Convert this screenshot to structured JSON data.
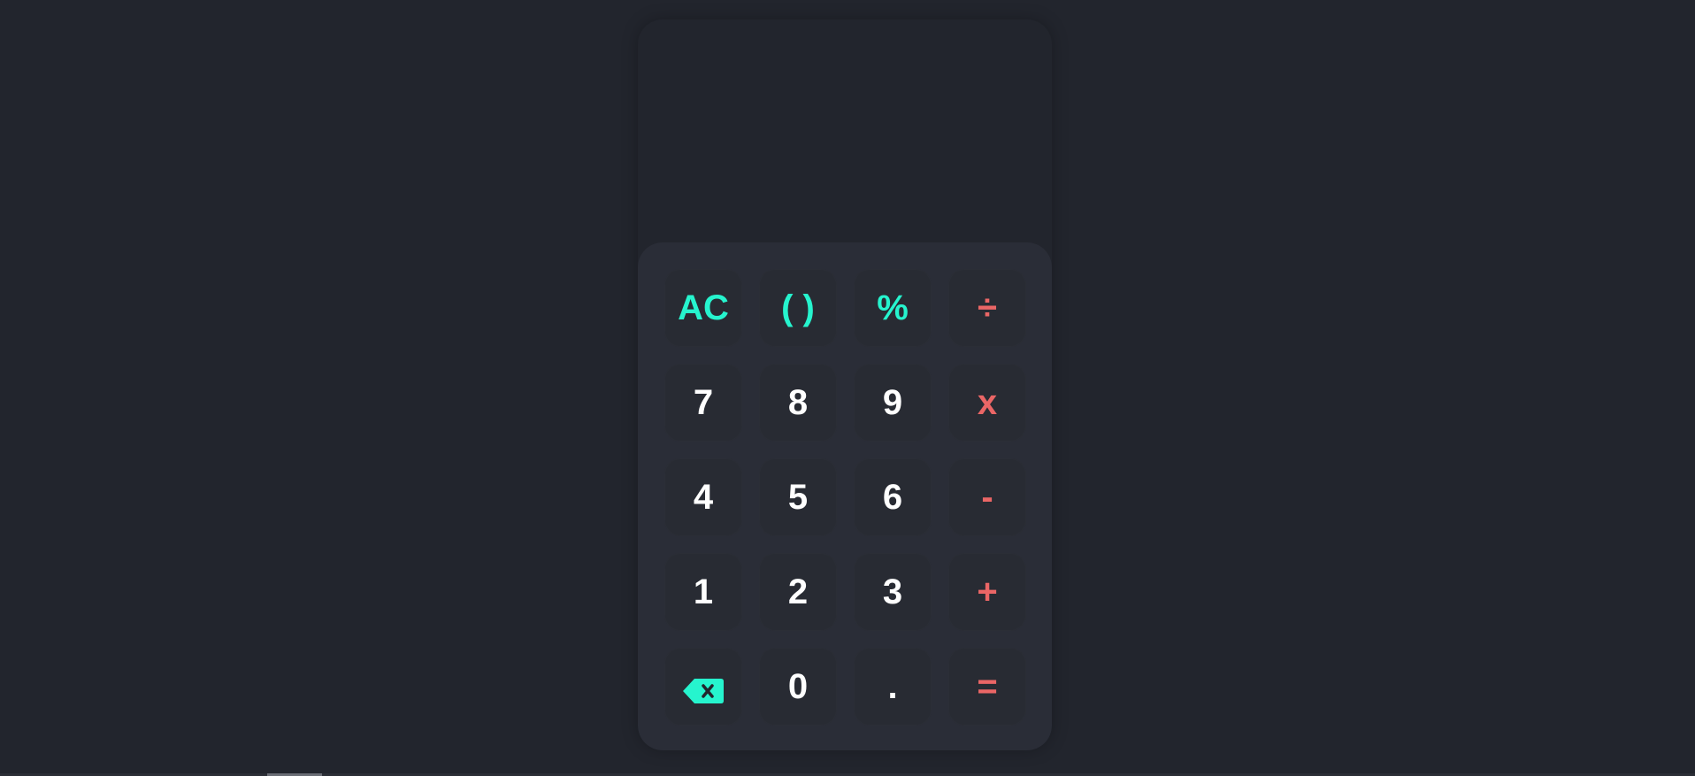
{
  "calculator": {
    "display": {
      "value": ""
    },
    "keys": [
      {
        "label": "AC",
        "type": "fn",
        "name": "clear-button"
      },
      {
        "label": "( )",
        "type": "fn",
        "name": "parentheses-button"
      },
      {
        "label": "%",
        "type": "fn",
        "name": "percent-button"
      },
      {
        "label": "÷",
        "type": "op",
        "name": "divide-button"
      },
      {
        "label": "7",
        "type": "num",
        "name": "digit-7-button"
      },
      {
        "label": "8",
        "type": "num",
        "name": "digit-8-button"
      },
      {
        "label": "9",
        "type": "num",
        "name": "digit-9-button"
      },
      {
        "label": "x",
        "type": "op",
        "name": "multiply-button"
      },
      {
        "label": "4",
        "type": "num",
        "name": "digit-4-button"
      },
      {
        "label": "5",
        "type": "num",
        "name": "digit-5-button"
      },
      {
        "label": "6",
        "type": "num",
        "name": "digit-6-button"
      },
      {
        "label": "-",
        "type": "op",
        "name": "subtract-button"
      },
      {
        "label": "1",
        "type": "num",
        "name": "digit-1-button"
      },
      {
        "label": "2",
        "type": "num",
        "name": "digit-2-button"
      },
      {
        "label": "3",
        "type": "num",
        "name": "digit-3-button"
      },
      {
        "label": "+",
        "type": "op",
        "name": "add-button"
      },
      {
        "icon": "backspace-icon",
        "type": "fn",
        "name": "backspace-button"
      },
      {
        "label": "0",
        "type": "num",
        "name": "digit-0-button"
      },
      {
        "label": ".",
        "type": "num",
        "name": "decimal-button"
      },
      {
        "label": "=",
        "type": "op",
        "name": "equals-button"
      }
    ]
  },
  "colors": {
    "background": "#22252d",
    "keypad": "#2a2d37",
    "key": "#282b33",
    "function_accent": "#26f4ce",
    "operator_accent": "#eb6666",
    "digit": "#ffffff"
  }
}
